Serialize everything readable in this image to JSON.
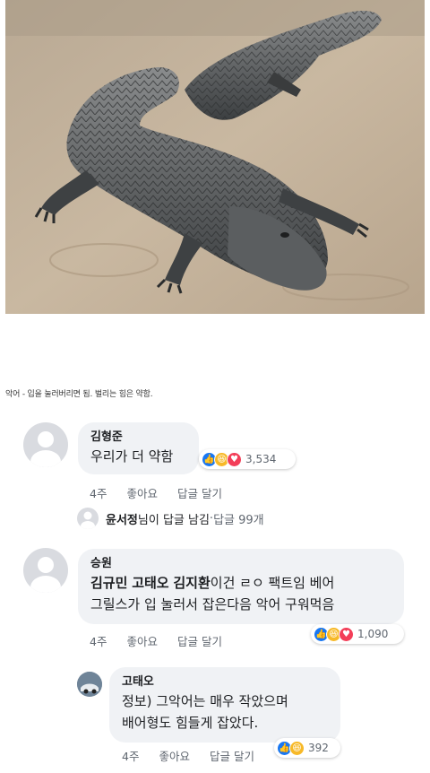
{
  "photo": {
    "alt_icon": "alligator-photo"
  },
  "caption": "악어 - 입을 눌러버리면 됨. 벌리는 힘은 약함.",
  "comments": [
    {
      "author": "김형준",
      "text": "우리가 더 약함",
      "time": "4주",
      "like": "좋아요",
      "reply": "답글 달기",
      "reaction_count": "3,534"
    },
    {
      "author": "승원",
      "tags": [
        "김규민",
        "고태오",
        "김지환"
      ],
      "text_after_tags": "이건 ㄹㅇ 팩트임 베어",
      "text_line2": "그릴스가 입 눌러서 잡은다음 악어 구워먹음",
      "time": "4주",
      "like": "좋아요",
      "reply": "답글 달기",
      "reaction_count": "1,090"
    },
    {
      "author": "고태오",
      "text_line1": "정보) 그악어는 매우 작았으며",
      "text_line2": "배어형도 힘들게 잡았다.",
      "time": "4주",
      "like": "좋아요",
      "reply": "답글 달기",
      "reaction_count": "392"
    }
  ],
  "reply_summary": {
    "name": "윤서정",
    "text": "님이 답글 남김",
    "sep": " · ",
    "count": "답글 99개"
  }
}
